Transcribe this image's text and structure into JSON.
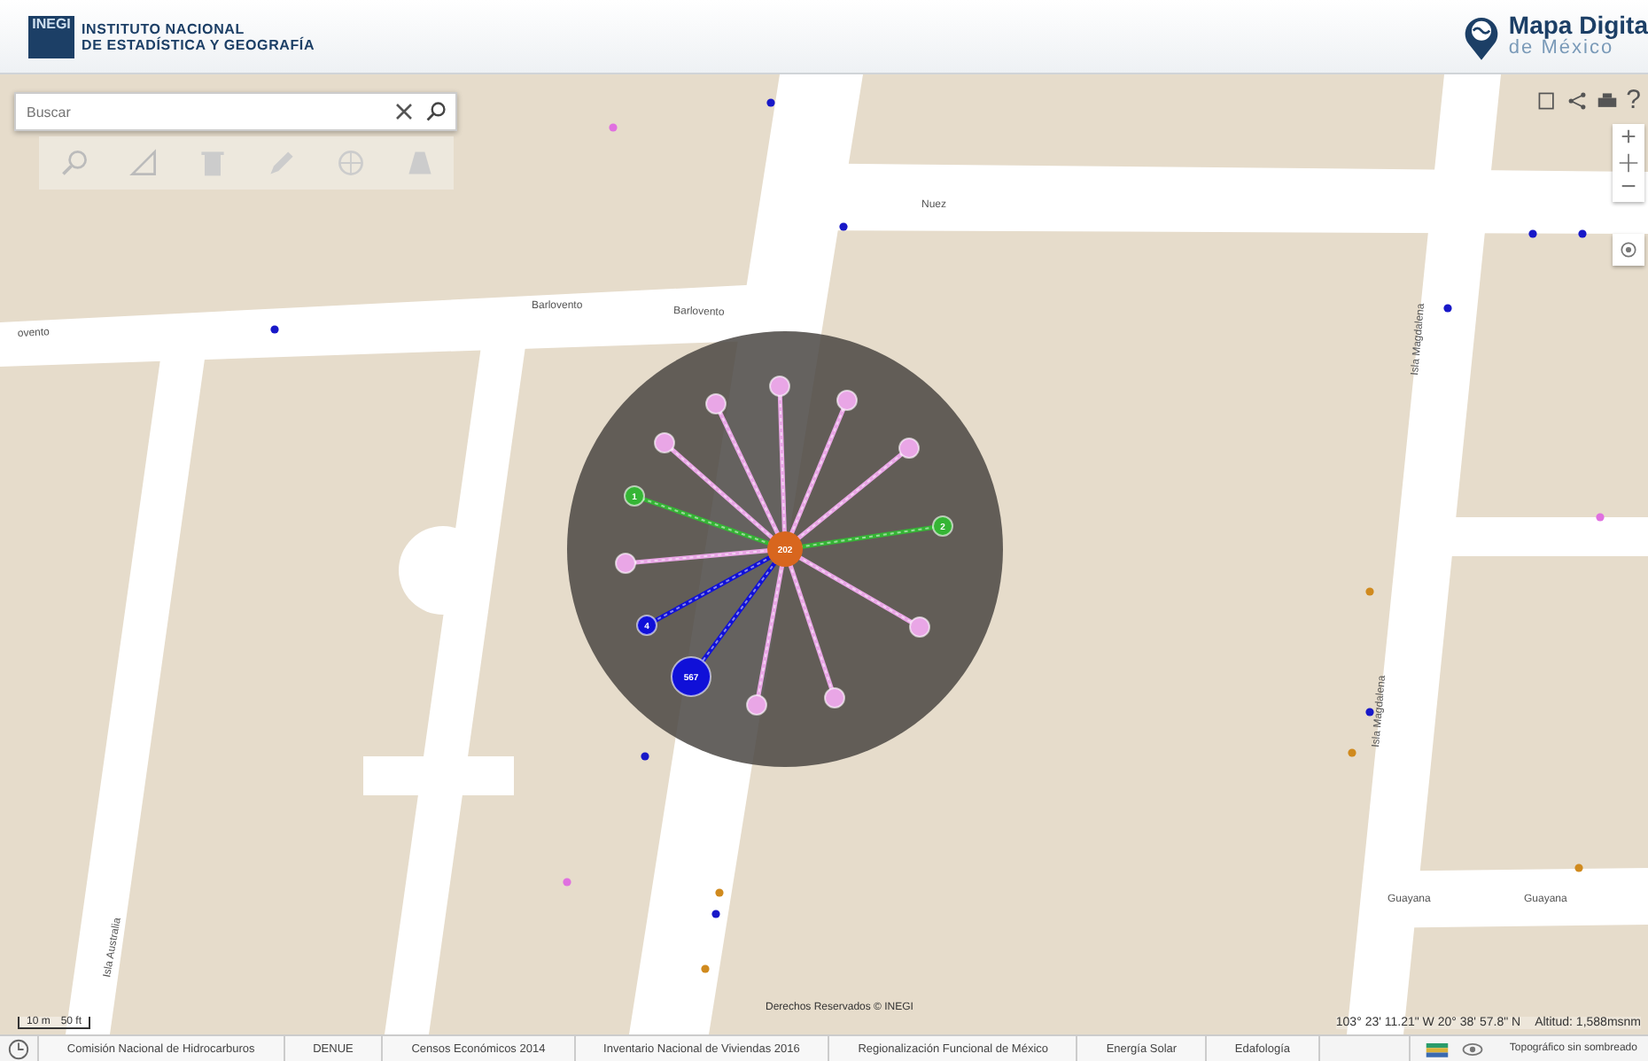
{
  "header": {
    "org_line_1": "INSTITUTO NACIONAL",
    "org_line_2": "DE ESTADÍSTICA Y GEOGRAFÍA",
    "logo_text": "INEGI",
    "app_title": "Mapa Digita",
    "app_subtitle": "de México"
  },
  "search": {
    "placeholder": "Buscar"
  },
  "map_tools": {
    "help": "?",
    "zoom_in": "+",
    "zoom_out": "−"
  },
  "streets": [
    {
      "name": "Nuez"
    },
    {
      "name": "Barlovento"
    },
    {
      "name": "Barlovento"
    },
    {
      "name": "ovento"
    },
    {
      "name": "Isla Magdalena"
    },
    {
      "name": "Isla Magdalena"
    },
    {
      "name": "Guayana"
    },
    {
      "name": "Guayana"
    },
    {
      "name": "Isla Australia"
    }
  ],
  "cluster": {
    "center": {
      "label": "202",
      "color": "#d8661e"
    },
    "nodes": [
      {
        "color": "#e9a6e6"
      },
      {
        "color": "#e9a6e6"
      },
      {
        "color": "#e9a6e6"
      },
      {
        "color": "#e9a6e6"
      },
      {
        "color": "#e9a6e6"
      },
      {
        "label": "1",
        "color": "#35b535"
      },
      {
        "label": "2",
        "color": "#35b535"
      },
      {
        "color": "#e9a6e6"
      },
      {
        "label": "4",
        "color": "#1010d8"
      },
      {
        "label": "567",
        "color": "#1010d8"
      },
      {
        "color": "#e9a6e6"
      },
      {
        "color": "#e9a6e6"
      },
      {
        "color": "#e9a6e6"
      }
    ]
  },
  "scale": {
    "metric": "10 m",
    "imperial": "50 ft"
  },
  "copyright": "Derechos Reservados © INEGI",
  "coordinates": "103° 23' 11.21\" W 20° 38' 57.8\" N",
  "altitude": "Altitud: 1,588msnm",
  "layer_tabs": [
    "Comisión Nacional de Hidrocarburos",
    "DENUE",
    "Censos Económicos 2014",
    "Inventario Nacional de Viviendas 2016",
    "Regionalización Funcional de México",
    "Energía Solar",
    "Edafología"
  ],
  "base_map": "Topográfico sin sombreado"
}
